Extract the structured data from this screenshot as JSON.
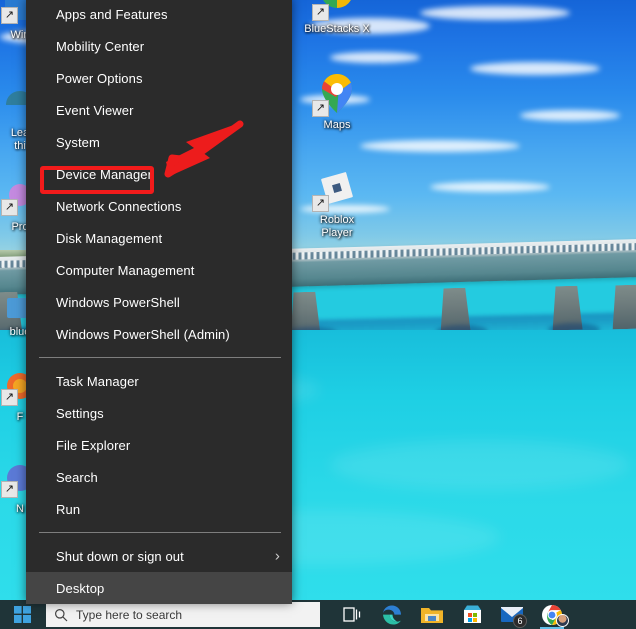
{
  "desktop": {
    "wallpaper_description": "Bridge over turquoise tropical sea",
    "icons": [
      {
        "label": "BlueStacks X",
        "icon": "bluestacks-icon",
        "shortcut": true
      },
      {
        "label": "Maps",
        "icon": "google-maps-pin-icon",
        "shortcut": true
      },
      {
        "label": "Roblox\nPlayer",
        "label_line1": "Roblox",
        "label_line2": "Player",
        "icon": "roblox-icon",
        "shortcut": true
      }
    ],
    "clipped_icons": [
      {
        "label": "Win",
        "icon": "generic-shortcut-icon"
      },
      {
        "label_line1": "Lea",
        "label_line2": "thi",
        "icon": "edge-tips-icon"
      },
      {
        "label": "Pro",
        "icon": "generic-shortcut-icon"
      },
      {
        "label": "blue",
        "icon": "generic-icon"
      },
      {
        "label": "F",
        "icon": "firefox-icon"
      },
      {
        "label": "N",
        "icon": "generic-shortcut-icon"
      }
    ]
  },
  "winx_menu": {
    "items": [
      {
        "label": "Apps and Features",
        "type": "item"
      },
      {
        "label": "Mobility Center",
        "type": "item"
      },
      {
        "label": "Power Options",
        "type": "item"
      },
      {
        "label": "Event Viewer",
        "type": "item"
      },
      {
        "label": "System",
        "type": "item"
      },
      {
        "label": "Device Manager",
        "type": "item",
        "highlighted_annotation": true
      },
      {
        "label": "Network Connections",
        "type": "item"
      },
      {
        "label": "Disk Management",
        "type": "item"
      },
      {
        "label": "Computer Management",
        "type": "item"
      },
      {
        "label": "Windows PowerShell",
        "type": "item"
      },
      {
        "label": "Windows PowerShell (Admin)",
        "type": "item"
      },
      {
        "label": "",
        "type": "separator"
      },
      {
        "label": "Task Manager",
        "type": "item"
      },
      {
        "label": "Settings",
        "type": "item"
      },
      {
        "label": "File Explorer",
        "type": "item"
      },
      {
        "label": "Search",
        "type": "item"
      },
      {
        "label": "Run",
        "type": "item"
      },
      {
        "label": "",
        "type": "separator"
      },
      {
        "label": "Shut down or sign out",
        "type": "submenu",
        "chevron": "›"
      },
      {
        "label": "Desktop",
        "type": "item",
        "selected": true
      }
    ],
    "background_color": "#2b2b2b",
    "highlight_color": "#454545",
    "text_color": "#ffffff"
  },
  "annotation": {
    "highlight_box_color": "#f21b1b",
    "arrow_color": "#ed1c1c",
    "target_label": "Device Manager"
  },
  "taskbar": {
    "background_color": "#1f3438",
    "start_button": {
      "name": "start-button",
      "icon": "windows-logo-icon"
    },
    "search": {
      "placeholder": "Type here to search",
      "icon": "search-icon"
    },
    "buttons": [
      {
        "name": "task-view",
        "icon": "task-view-icon",
        "label": ""
      },
      {
        "name": "microsoft-edge",
        "icon": "edge-icon",
        "label": ""
      },
      {
        "name": "file-explorer",
        "icon": "folder-icon",
        "label": ""
      },
      {
        "name": "microsoft-store",
        "icon": "store-icon",
        "label": ""
      },
      {
        "name": "mail",
        "icon": "mail-icon",
        "label": "",
        "badge": "6"
      },
      {
        "name": "google-chrome",
        "icon": "chrome-icon",
        "label": "",
        "running": true
      }
    ]
  }
}
